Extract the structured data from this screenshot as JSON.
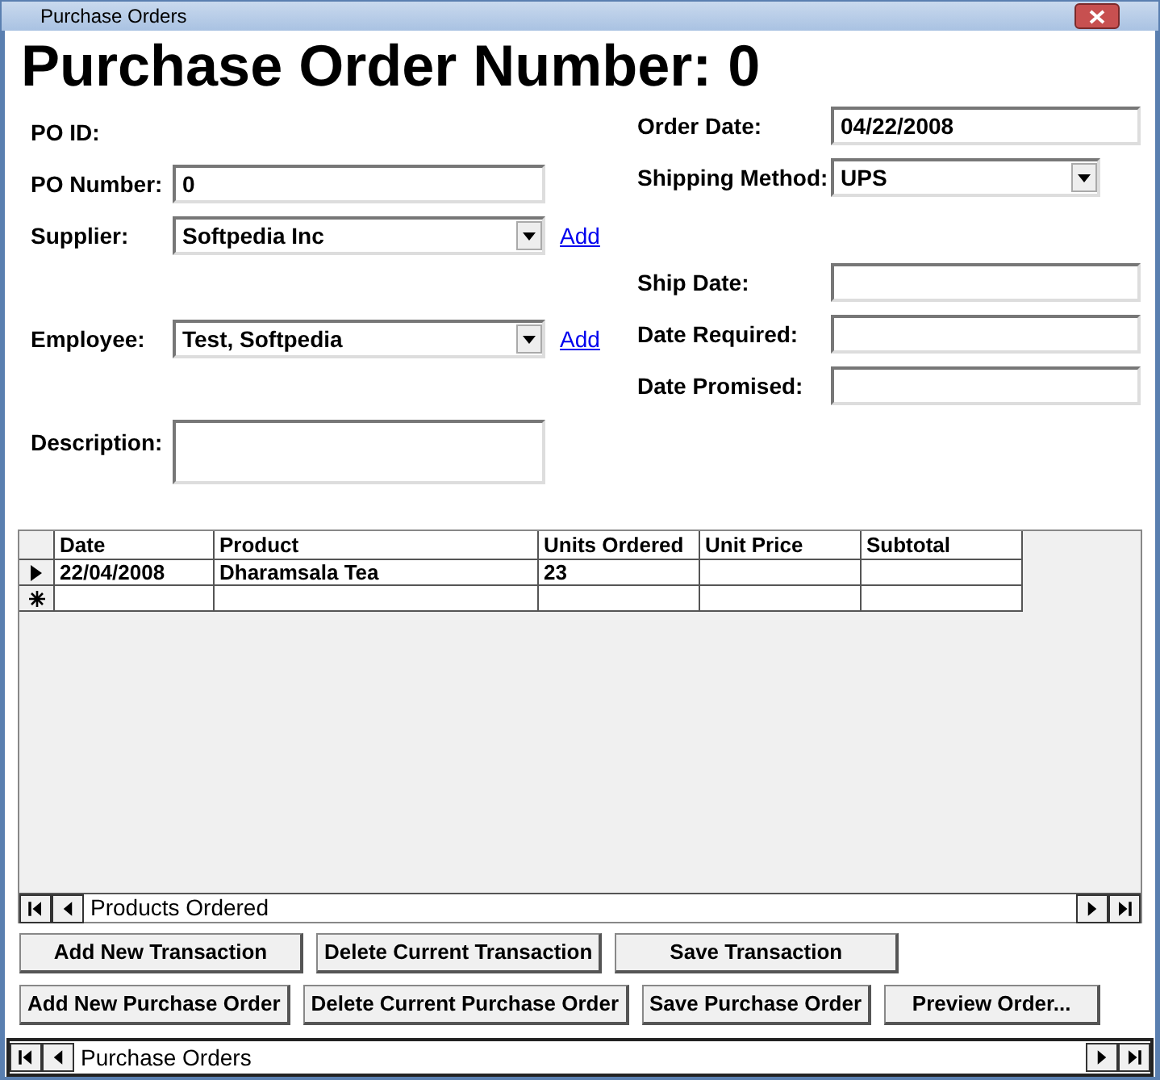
{
  "window": {
    "title": "Purchase Orders"
  },
  "heading": "Purchase Order Number: 0",
  "left_fields": [
    {
      "kind": "label",
      "label": "PO ID:"
    },
    {
      "kind": "text",
      "label": "PO Number:",
      "value": "0"
    },
    {
      "kind": "combo",
      "label": "Supplier:",
      "value": "Softpedia Inc",
      "link": "Add"
    },
    {
      "kind": "combo",
      "label": "Employee:",
      "value": "Test, Softpedia",
      "link": "Add"
    },
    {
      "kind": "memo",
      "label": "Description:"
    }
  ],
  "right_fields": [
    {
      "kind": "text",
      "label": "Order Date:",
      "value": "04/22/2008"
    },
    {
      "kind": "combo",
      "label": "Shipping Method:",
      "value": "UPS"
    },
    {
      "kind": "text",
      "label": "Ship Date:"
    },
    {
      "kind": "text",
      "label": "Date Required:"
    },
    {
      "kind": "text",
      "label": "Date Promised:"
    }
  ],
  "table": {
    "columns": [
      "Date",
      "Product",
      "Units Ordered",
      "Unit Price",
      "Subtotal"
    ],
    "rows": [
      {
        "kind": "record",
        "current": true,
        "cells": [
          "22/04/2008",
          "Dharamsala Tea",
          "23",
          "",
          ""
        ]
      },
      {
        "kind": "new",
        "current": false,
        "cells": [
          "",
          "",
          "",
          "",
          ""
        ]
      }
    ]
  },
  "subform_nav": {
    "label": "Products Ordered"
  },
  "button_rows": [
    [
      "Add New Transaction",
      "Delete Current Transaction",
      "Save Transaction"
    ],
    [
      "Add New Purchase Order",
      "Delete Current Purchase Order",
      "Save Purchase Order",
      "Preview Order..."
    ]
  ],
  "form_nav": {
    "label": "Purchase Orders"
  }
}
